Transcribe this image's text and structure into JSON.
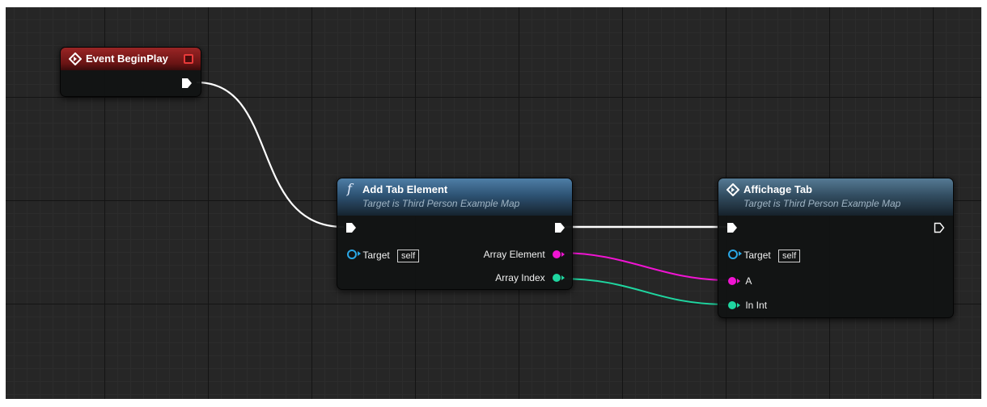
{
  "nodes": {
    "begin_play": {
      "title": "Event BeginPlay"
    },
    "add_tab": {
      "title": "Add Tab Element",
      "subtitle": "Target is Third Person Example Map",
      "pins": {
        "target": "Target",
        "target_default": "self",
        "array_element": "Array Element",
        "array_index": "Array Index"
      }
    },
    "affichage": {
      "title": "Affichage Tab",
      "subtitle": "Target is Third Person Example Map",
      "pins": {
        "target": "Target",
        "target_default": "self",
        "a": "A",
        "in_int": "In Int"
      }
    }
  },
  "colors": {
    "exec": "#ffffff",
    "object_pin": "#2aa7e6",
    "wildcard_pin": "#f014d2",
    "int_pin": "#1fd6a0"
  },
  "icons": {
    "event": "diamond-arrow-icon",
    "function": "function-f-icon",
    "custom": "diamond-arrow-icon",
    "delegate": "delegate-square-icon"
  }
}
